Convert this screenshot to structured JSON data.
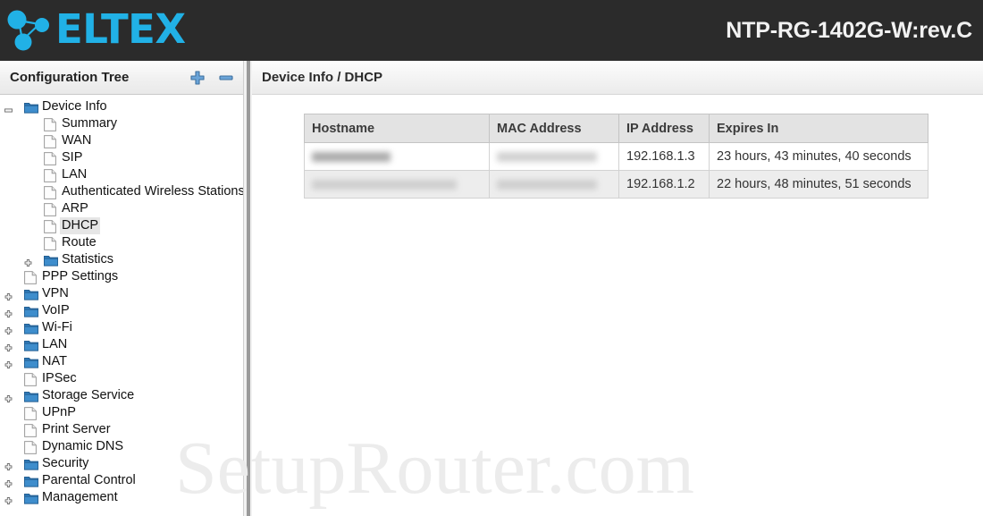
{
  "header": {
    "brand_name": "ELTEX",
    "brand_color": "#21b1e6",
    "background_color": "#2b2b2b",
    "device_model": "NTP-RG-1402G-W:rev.C"
  },
  "sidebar": {
    "title": "Configuration Tree",
    "expand_all_icon": "plus-icon",
    "collapse_all_icon": "minus-icon",
    "items": [
      {
        "label": "Device Info",
        "depth": 0,
        "icon": "folder-icon",
        "expander": "minus",
        "selected": false
      },
      {
        "label": "Summary",
        "depth": 1,
        "icon": "page-icon",
        "expander": "none",
        "selected": false
      },
      {
        "label": "WAN",
        "depth": 1,
        "icon": "page-icon",
        "expander": "none",
        "selected": false
      },
      {
        "label": "SIP",
        "depth": 1,
        "icon": "page-icon",
        "expander": "none",
        "selected": false
      },
      {
        "label": "LAN",
        "depth": 1,
        "icon": "page-icon",
        "expander": "none",
        "selected": false
      },
      {
        "label": "Authenticated Wireless Stations",
        "depth": 1,
        "icon": "page-icon",
        "expander": "none",
        "selected": false
      },
      {
        "label": "ARP",
        "depth": 1,
        "icon": "page-icon",
        "expander": "none",
        "selected": false
      },
      {
        "label": "DHCP",
        "depth": 1,
        "icon": "page-icon",
        "expander": "none",
        "selected": true
      },
      {
        "label": "Route",
        "depth": 1,
        "icon": "page-icon",
        "expander": "none",
        "selected": false
      },
      {
        "label": "Statistics",
        "depth": 1,
        "icon": "folder-icon",
        "expander": "plus",
        "selected": false
      },
      {
        "label": "PPP Settings",
        "depth": 0,
        "icon": "page-icon",
        "expander": "none",
        "selected": false
      },
      {
        "label": "VPN",
        "depth": 0,
        "icon": "folder-icon",
        "expander": "plus",
        "selected": false
      },
      {
        "label": "VoIP",
        "depth": 0,
        "icon": "folder-icon",
        "expander": "plus",
        "selected": false
      },
      {
        "label": "Wi-Fi",
        "depth": 0,
        "icon": "folder-icon",
        "expander": "plus",
        "selected": false
      },
      {
        "label": "LAN",
        "depth": 0,
        "icon": "folder-icon",
        "expander": "plus",
        "selected": false
      },
      {
        "label": "NAT",
        "depth": 0,
        "icon": "folder-icon",
        "expander": "plus",
        "selected": false
      },
      {
        "label": "IPSec",
        "depth": 0,
        "icon": "page-icon",
        "expander": "none",
        "selected": false
      },
      {
        "label": "Storage Service",
        "depth": 0,
        "icon": "folder-icon",
        "expander": "plus",
        "selected": false
      },
      {
        "label": "UPnP",
        "depth": 0,
        "icon": "page-icon",
        "expander": "none",
        "selected": false
      },
      {
        "label": "Print Server",
        "depth": 0,
        "icon": "page-icon",
        "expander": "none",
        "selected": false
      },
      {
        "label": "Dynamic DNS",
        "depth": 0,
        "icon": "page-icon",
        "expander": "none",
        "selected": false
      },
      {
        "label": "Security",
        "depth": 0,
        "icon": "folder-icon",
        "expander": "plus",
        "selected": false
      },
      {
        "label": "Parental Control",
        "depth": 0,
        "icon": "folder-icon",
        "expander": "plus",
        "selected": false
      },
      {
        "label": "Management",
        "depth": 0,
        "icon": "folder-icon",
        "expander": "plus",
        "selected": false
      }
    ]
  },
  "main": {
    "breadcrumb": "Device Info / DHCP",
    "table": {
      "columns": [
        "Hostname",
        "MAC Address",
        "IP Address",
        "Expires In"
      ],
      "rows": [
        {
          "hostname": "",
          "hostname_redacted": true,
          "mac_address": "",
          "mac_redacted": true,
          "ip_address": "192.168.1.3",
          "expires_in": "23 hours, 43 minutes, 40 seconds"
        },
        {
          "hostname": "",
          "hostname_redacted": true,
          "mac_address": "",
          "mac_redacted": true,
          "ip_address": "192.168.1.2",
          "expires_in": "22 hours, 48 minutes, 51 seconds"
        }
      ]
    }
  },
  "watermark": {
    "text": "SetupRouter.com"
  }
}
